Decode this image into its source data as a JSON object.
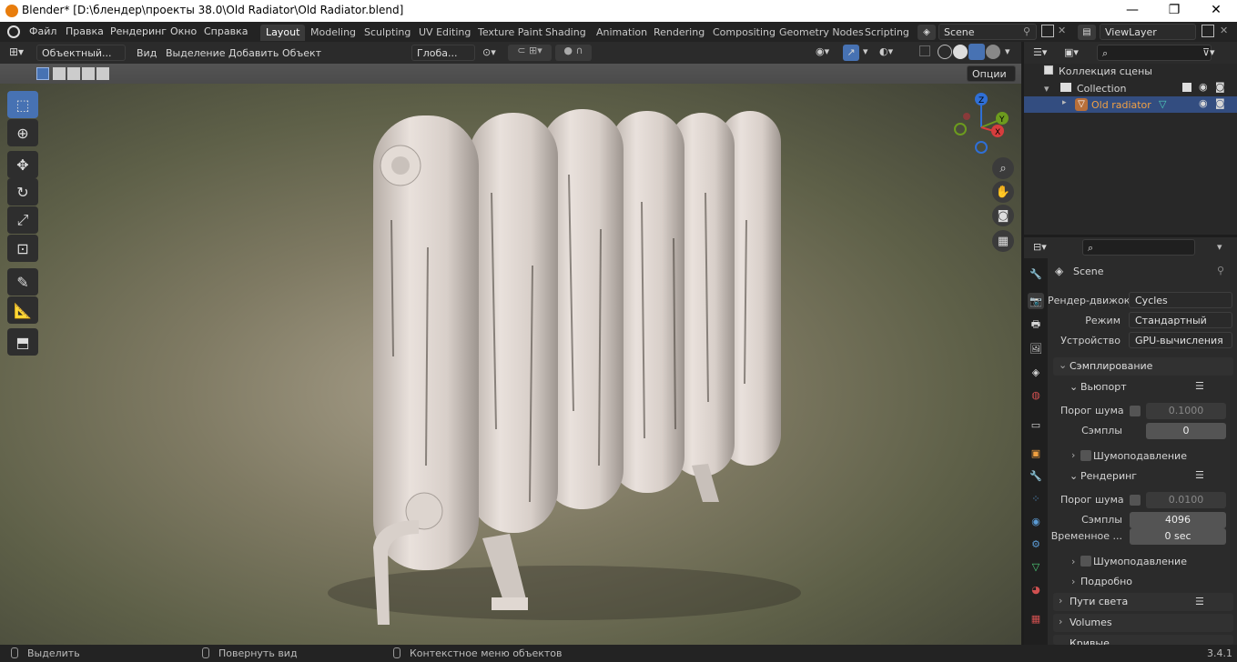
{
  "titlebar": {
    "title": "Blender* [D:\\блендер\\проекты 38.0\\Old Radiator\\Old Radiator.blend]",
    "min": "—",
    "max": "❐",
    "close": "✕"
  },
  "menu": [
    "Файл",
    "Правка",
    "Рендеринг",
    "Окно",
    "Справка"
  ],
  "workspaces": [
    "Layout",
    "Modeling",
    "Sculpting",
    "UV Editing",
    "Texture Paint",
    "Shading",
    "Animation",
    "Rendering",
    "Compositing",
    "Geometry Nodes",
    "Scripting"
  ],
  "scene_name": "Scene",
  "view_layer": "ViewLayer",
  "viewport_header": {
    "mode": "Объектный...",
    "view": "Вид",
    "select": "Выделение",
    "add": "Добавить",
    "object": "Объект",
    "orientation": "Глоба...",
    "options": "Опции"
  },
  "gizmo": {
    "z": "Z",
    "y": "Y",
    "x": "X"
  },
  "outliner": {
    "scene_collection": "Коллекция сцены",
    "collection": "Collection",
    "object": "Old radiator"
  },
  "properties": {
    "context": "Scene",
    "engine_label": "Рендер-движок",
    "engine_value": "Cycles",
    "mode_label": "Режим",
    "mode_value": "Стандартный",
    "device_label": "Устройство",
    "device_value": "GPU-вычисления",
    "sampling": "Сэмплирование",
    "viewport": "Вьюпорт",
    "noise_label": "Порог шума",
    "vp_noise": "0.1000",
    "samples_label": "Сэмплы",
    "vp_samples": "0",
    "denoise": "Шумоподавление",
    "render": "Рендеринг",
    "r_noise": "0.0100",
    "r_samples": "4096",
    "time_label": "Временное ...",
    "time_value": "0 sec",
    "details": "Подробно",
    "light_paths": "Пути света",
    "volumes": "Volumes",
    "curves": "Кривые"
  },
  "status": {
    "select": "Выделить",
    "rotate": "Повернуть вид",
    "context": "Контекстное меню объектов",
    "version": "3.4.1"
  }
}
